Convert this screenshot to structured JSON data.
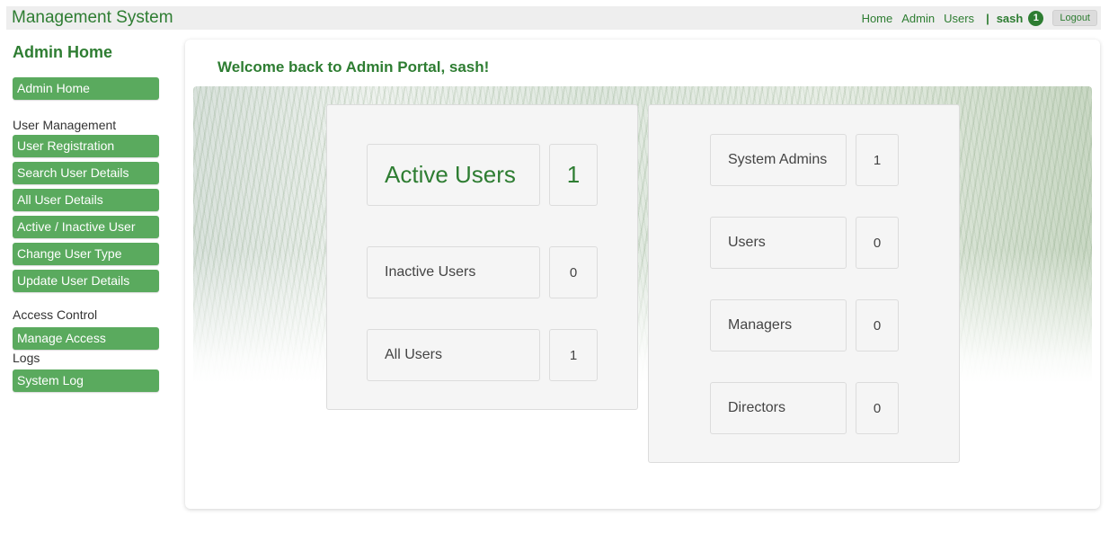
{
  "app": {
    "title": "Management System"
  },
  "topnav": {
    "links": [
      "Home",
      "Admin",
      "Users"
    ],
    "separator": "|",
    "username": "sash",
    "notification_count": "1",
    "logout_label": "Logout"
  },
  "sidebar": {
    "title": "Admin Home",
    "home_button": "Admin Home",
    "sections": [
      {
        "heading": "User Management",
        "items": [
          "User Registration",
          "Search User Details",
          "All User Details",
          "Active / Inactive User",
          "Change User Type",
          "Update User Details"
        ]
      },
      {
        "heading": "Access Control",
        "items": [
          "Manage Access"
        ]
      },
      {
        "heading": "Logs",
        "items": [
          "System Log"
        ]
      }
    ]
  },
  "main": {
    "welcome": "Welcome back to Admin Portal, sash!",
    "user_status": [
      {
        "label": "Active Users",
        "value": "1"
      },
      {
        "label": "Inactive Users",
        "value": "0"
      },
      {
        "label": "All Users",
        "value": "1"
      }
    ],
    "user_types": [
      {
        "label": "System Admins",
        "value": "1"
      },
      {
        "label": "Users",
        "value": "0"
      },
      {
        "label": "Managers",
        "value": "0"
      },
      {
        "label": "Directors",
        "value": "0"
      }
    ]
  },
  "colors": {
    "accent": "#2e7d32",
    "sidebar_button": "#5aaa5e"
  }
}
